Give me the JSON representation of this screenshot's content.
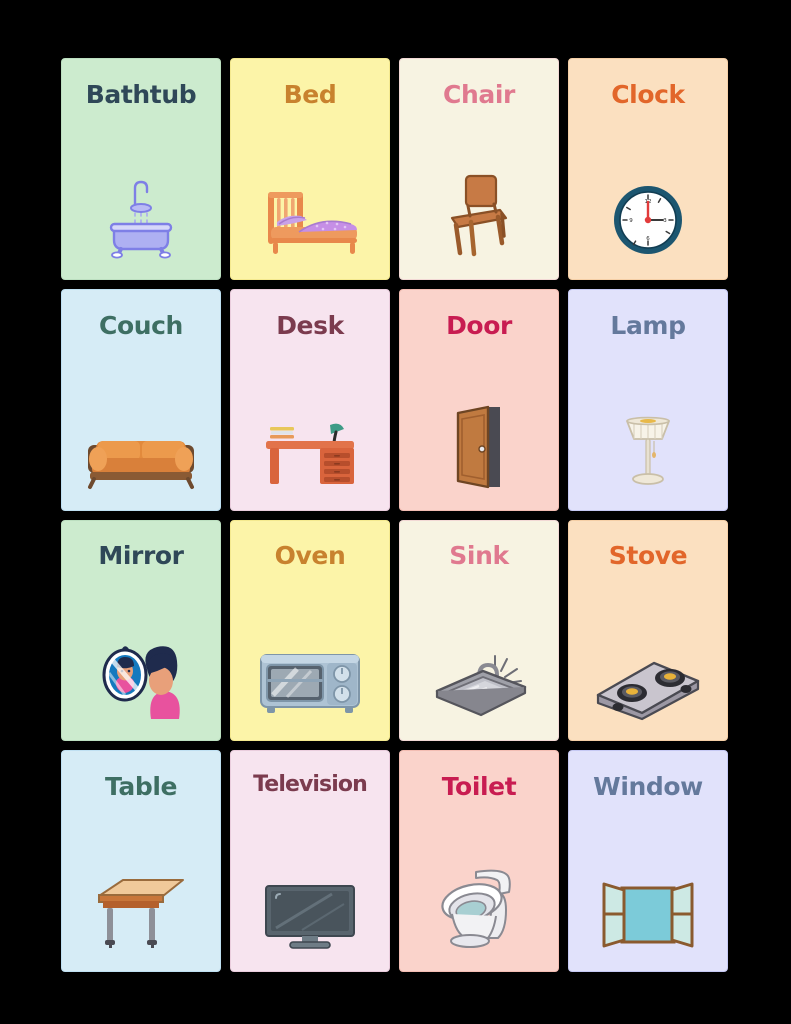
{
  "page": {
    "background": "#000000",
    "title": "Household objects picture flashcards",
    "grid": {
      "rows": 4,
      "columns": 4,
      "count": 16
    }
  },
  "cards": [
    {
      "label": "Bathtub",
      "icon": "bathtub-icon",
      "bg": "#CCEBCE",
      "fg": "#2F4858",
      "border": "#BCDFC0"
    },
    {
      "label": "Bed",
      "icon": "bed-icon",
      "bg": "#FCF4A8",
      "fg": "#C8822E",
      "border": "#F4E98F"
    },
    {
      "label": "Chair",
      "icon": "chair-icon",
      "bg": "#F7F3E2",
      "fg": "#E0798F",
      "border": "#F2D8D5"
    },
    {
      "label": "Clock",
      "icon": "clock-icon",
      "bg": "#FBE0C0",
      "fg": "#E2662A",
      "border": "#F5CFA6"
    },
    {
      "label": "Couch",
      "icon": "couch-icon",
      "bg": "#D6ECF6",
      "fg": "#3E6F63",
      "border": "#BFE0F2"
    },
    {
      "label": "Desk",
      "icon": "desk-icon",
      "bg": "#F7E4EF",
      "fg": "#7B3B4E",
      "border": "#EACDDD"
    },
    {
      "label": "Door",
      "icon": "door-icon",
      "bg": "#FAD3CB",
      "fg": "#C81C51",
      "border": "#F3BDB3"
    },
    {
      "label": "Lamp",
      "icon": "lamp-icon",
      "bg": "#E1E2FB",
      "fg": "#64799C",
      "border": "#C6C9F4"
    },
    {
      "label": "Mirror",
      "icon": "mirror-icon",
      "bg": "#CCEBCE",
      "fg": "#2F4858",
      "border": "#BCDFC0"
    },
    {
      "label": "Oven",
      "icon": "oven-icon",
      "bg": "#FCF4A8",
      "fg": "#C8822E",
      "border": "#F4E98F"
    },
    {
      "label": "Sink",
      "icon": "sink-icon",
      "bg": "#F7F3E2",
      "fg": "#E0798F",
      "border": "#F2D8D5"
    },
    {
      "label": "Stove",
      "icon": "stove-icon",
      "bg": "#FBE0C0",
      "fg": "#E2662A",
      "border": "#F5CFA6"
    },
    {
      "label": "Table",
      "icon": "table-icon",
      "bg": "#D6ECF6",
      "fg": "#3E6F63",
      "border": "#BFE0F2"
    },
    {
      "label": "Television",
      "icon": "television-icon",
      "bg": "#F7E4EF",
      "fg": "#7B3B4E",
      "border": "#EACDDD"
    },
    {
      "label": "Toilet",
      "icon": "toilet-icon",
      "bg": "#FAD3CB",
      "fg": "#C81C51",
      "border": "#F3BDB3"
    },
    {
      "label": "Window",
      "icon": "window-icon",
      "bg": "#E1E2FB",
      "fg": "#64799C",
      "border": "#C6C9F4"
    }
  ]
}
